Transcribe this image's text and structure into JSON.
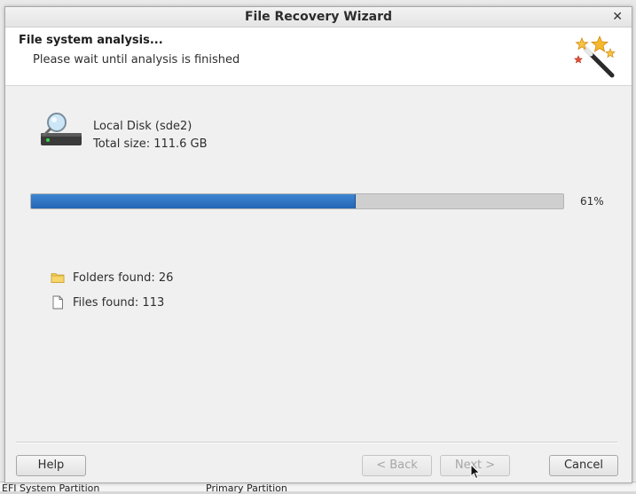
{
  "window": {
    "title": "File Recovery Wizard",
    "close_glyph": "✕"
  },
  "header": {
    "title": "File system analysis...",
    "subtitle": "Please wait until analysis is finished",
    "icon": "magic-wand-icon"
  },
  "disk": {
    "name": "Local Disk (sde2)",
    "size": "Total size: 111.6 GB",
    "icon": "hard-disk-search-icon"
  },
  "progress": {
    "value": 61,
    "label": "61%"
  },
  "found": {
    "folders": "Folders found: 26",
    "files": "Files found: 113"
  },
  "buttons": {
    "help": "Help",
    "back": "< Back",
    "next": "Next >",
    "cancel": "Cancel"
  },
  "background": {
    "bottom_left": "EFI System Partition",
    "bottom_mid": "Primary Partition"
  },
  "colors": {
    "progress_fill": "#2d74c4",
    "progress_track": "#cfcfcf"
  }
}
